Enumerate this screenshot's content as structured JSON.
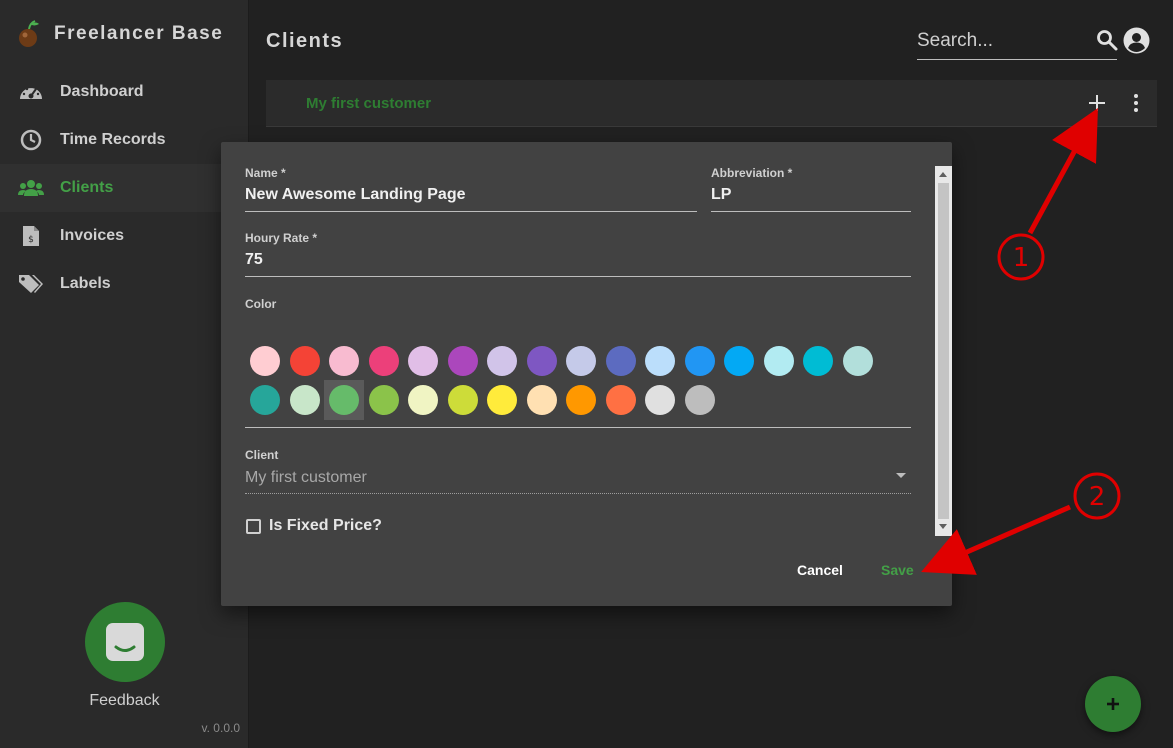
{
  "app": {
    "name": "Freelancer Base",
    "version": "v. 0.0.0"
  },
  "sidebar": {
    "items": [
      {
        "label": "Dashboard",
        "icon": "speedometer-icon",
        "active": false
      },
      {
        "label": "Time Records",
        "icon": "clock-icon",
        "active": false
      },
      {
        "label": "Clients",
        "icon": "users-icon",
        "active": true
      },
      {
        "label": "Invoices",
        "icon": "invoice-icon",
        "active": false
      },
      {
        "label": "Labels",
        "icon": "tags-icon",
        "active": false
      }
    ],
    "feedback_label": "Feedback"
  },
  "header": {
    "title": "Clients",
    "search_placeholder": "Search..."
  },
  "clients": [
    {
      "name": "My first customer"
    }
  ],
  "dialog": {
    "name_label": "Name *",
    "name_value": "New Awesome Landing Page",
    "abbreviation_label": "Abbreviation *",
    "abbreviation_value": "LP",
    "rate_label": "Houry Rate *",
    "rate_value": "75",
    "color_label": "Color",
    "colors": [
      "#ffcdd2",
      "#f44336",
      "#f8bbd0",
      "#ec407a",
      "#e1bee7",
      "#ab47bc",
      "#d1c4e9",
      "#7e57c2",
      "#c5cae9",
      "#5c6bc0",
      "#bbdefb",
      "#2196f3",
      "#03a9f4",
      "#b2ebf2",
      "#00bcd4",
      "#b2dfdb",
      "#26a69a",
      "#c8e6c9",
      "#66bb6a",
      "#8bc34a",
      "#f0f4c3",
      "#cddc39",
      "#ffeb3b",
      "#ffe0b2",
      "#ff9800",
      "#ff7043",
      "#e0e0e0",
      "#bdbdbd"
    ],
    "selected_color_index": 18,
    "client_label": "Client",
    "client_value": "My first customer",
    "fixed_price_label": "Is Fixed Price?",
    "fixed_price_checked": false,
    "cancel_label": "Cancel",
    "save_label": "Save"
  },
  "annotations": {
    "marker_1": "1",
    "marker_2": "2"
  },
  "colors": {
    "accent": "#43a047",
    "accent_dark": "#2e7d32",
    "annotation": "#e00000"
  }
}
